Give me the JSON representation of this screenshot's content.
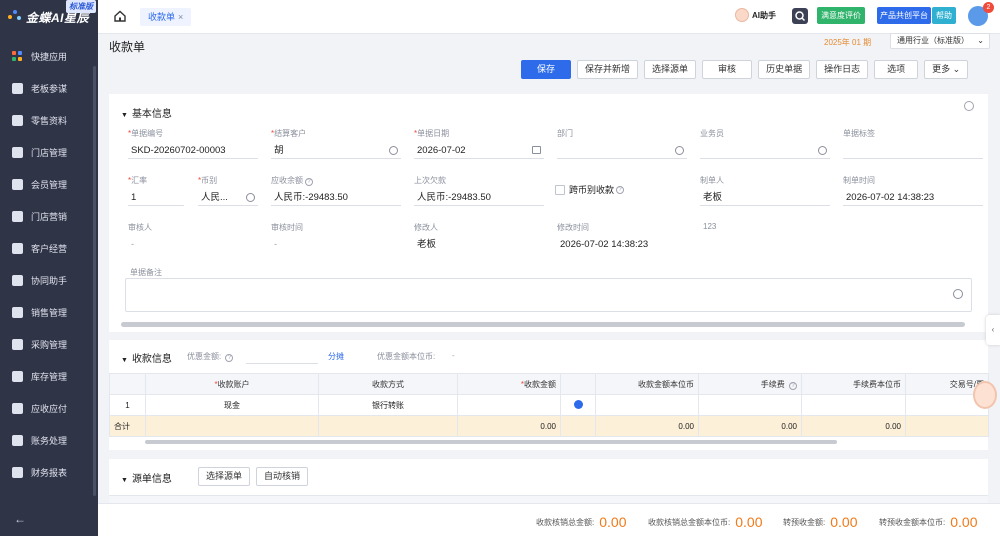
{
  "app": {
    "logo_text": "金蝶AI星辰",
    "logo_badge": "标准版"
  },
  "sidebar": {
    "items": [
      {
        "label": "快捷应用"
      },
      {
        "label": "老板参谋"
      },
      {
        "label": "零售资料"
      },
      {
        "label": "门店管理"
      },
      {
        "label": "会员管理"
      },
      {
        "label": "门店营销"
      },
      {
        "label": "客户经营"
      },
      {
        "label": "协同助手"
      },
      {
        "label": "销售管理"
      },
      {
        "label": "采购管理"
      },
      {
        "label": "库存管理"
      },
      {
        "label": "应收应付"
      },
      {
        "label": "账务处理"
      },
      {
        "label": "财务报表"
      }
    ]
  },
  "topbar": {
    "tab_label": "收款单",
    "tab_close": "×",
    "ai_label": "AI助手",
    "satisfaction": "满意度评价",
    "product": "产品共创平台",
    "help": "帮助",
    "notification_count": "2"
  },
  "header": {
    "title": "收款单",
    "period": "2025年 01 期",
    "industry": "通用行业（标准版）"
  },
  "toolbar": {
    "save": "保存",
    "save_new": "保存并新增",
    "select_source": "选择源单",
    "audit": "审核",
    "history": "历史单据",
    "log": "操作日志",
    "options": "选项",
    "more": "更多"
  },
  "basic": {
    "section_title": "基本信息",
    "doc_no": {
      "label": "单据编号",
      "value": "SKD-20260702-00003"
    },
    "customer": {
      "label": "结算客户",
      "value": "胡"
    },
    "doc_date": {
      "label": "单据日期",
      "value": "2026-07-02"
    },
    "department": {
      "label": "部门",
      "value": ""
    },
    "salesman": {
      "label": "业务员",
      "value": ""
    },
    "doc_tag": {
      "label": "单据标签",
      "value": ""
    },
    "exchange_rate": {
      "label": "汇率",
      "value": "1"
    },
    "currency": {
      "label": "币别",
      "value": "人民..."
    },
    "receivable_balance": {
      "label": "应收余额",
      "value": "人民币:-29483.50"
    },
    "last_arrears": {
      "label": "上次欠款",
      "value": "人民币:-29483.50"
    },
    "cross_currency": {
      "label": "跨币别收款"
    },
    "creator": {
      "label": "制单人",
      "value": "老板"
    },
    "create_time": {
      "label": "制单时间",
      "value": "2026-07-02 14:38:23"
    },
    "auditor": {
      "label": "审核人",
      "value": "-"
    },
    "audit_time": {
      "label": "审核时间",
      "value": "-"
    },
    "modifier": {
      "label": "修改人",
      "value": "老板"
    },
    "modify_time": {
      "label": "修改时间",
      "value": "2026-07-02 14:38:23"
    },
    "extra_number": "123",
    "remark_label": "单据备注"
  },
  "receipt": {
    "section_title": "收款信息",
    "discount_label": "优惠金额:",
    "share_link": "分摊",
    "discount_base_label": "优惠金额本位币:",
    "discount_base_value": "-",
    "columns": [
      "收款账户",
      "收款方式",
      "收款金额",
      "收款金额本位币",
      "手续费",
      "手续费本位币",
      "交易号/票"
    ],
    "rows": [
      {
        "no": "1",
        "account": "现金",
        "method": "银行转账",
        "amount": "",
        "amount_base": "",
        "fee": "",
        "fee_base": "",
        "txn": ""
      }
    ],
    "total": {
      "label": "合计",
      "amount": "0.00",
      "amount_base": "0.00",
      "fee": "0.00",
      "fee_base": "0.00"
    }
  },
  "source": {
    "section_title": "源单信息",
    "select_source": "选择源单",
    "auto_verify": "自动核销"
  },
  "summary": {
    "verify_total_label": "收款核销总金额:",
    "verify_total": "0.00",
    "verify_total_base_label": "收款核销总金额本位币:",
    "verify_total_base": "0.00",
    "prepaid_label": "转预收金额:",
    "prepaid": "0.00",
    "prepaid_base_label": "转预收金额本位币:",
    "prepaid_base": "0.00"
  },
  "colors": {
    "primary": "#2e6bea",
    "sidebar_bg": "#2f3447",
    "amount_orange": "#f07a1a",
    "required": "#f04a3a"
  }
}
